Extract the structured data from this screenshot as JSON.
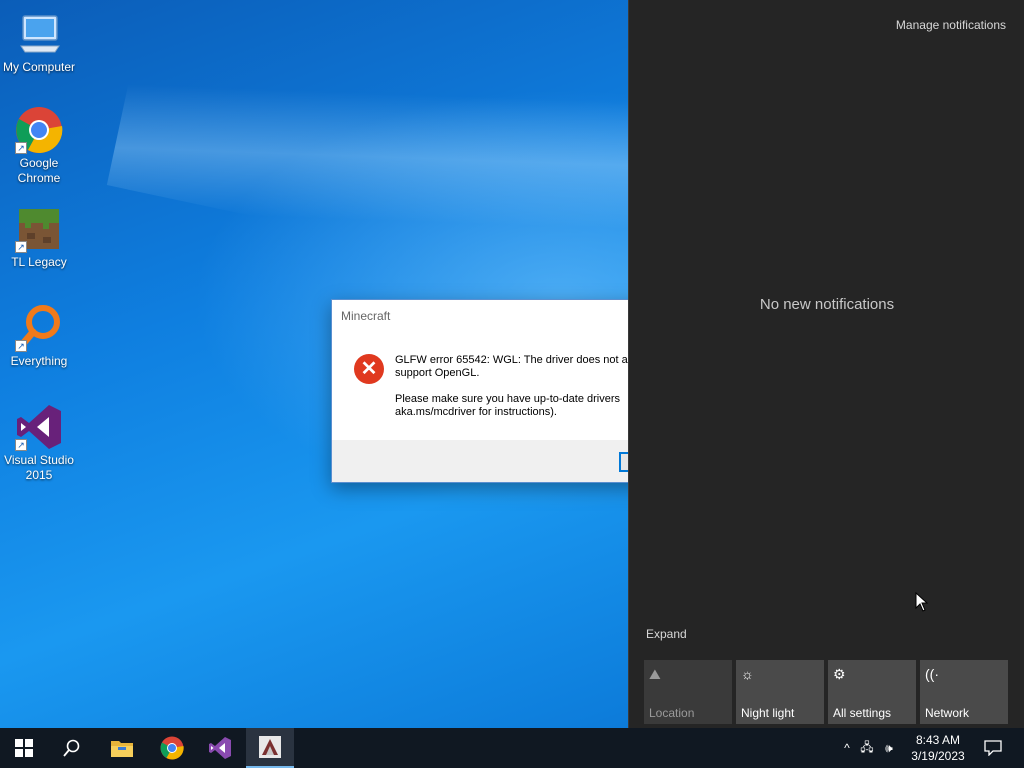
{
  "desktop": {
    "icons": [
      {
        "label": "My Computer",
        "icon": "computer-icon"
      },
      {
        "label": "Google Chrome",
        "icon": "chrome-icon"
      },
      {
        "label": "TL Legacy",
        "icon": "minecraft-block-icon"
      },
      {
        "label": "Everything",
        "icon": "magnifier-icon"
      },
      {
        "label": "Visual Studio 2015",
        "icon": "visual-studio-icon"
      }
    ]
  },
  "dialog": {
    "title": "Minecraft",
    "message": "GLFW error 65542: WGL: The driver does not a\nsupport OpenGL.\n\nPlease make sure you have up-to-date drivers\naka.ms/mcdriver for instructions).",
    "icon": "error-icon",
    "error_glyph": "✕"
  },
  "action_center": {
    "manage_label": "Manage notifications",
    "empty_label": "No new notifications",
    "expand_label": "Expand",
    "tiles": [
      {
        "label": "Location",
        "icon": "location-icon",
        "glyph": "⛰",
        "enabled": false
      },
      {
        "label": "Night light",
        "icon": "sun-icon",
        "glyph": "☼",
        "enabled": true
      },
      {
        "label": "All settings",
        "icon": "gear-icon",
        "glyph": "⚙",
        "enabled": true
      },
      {
        "label": "Network",
        "icon": "network-icon",
        "glyph": "((·",
        "enabled": true
      }
    ]
  },
  "taskbar": {
    "items": [
      {
        "name": "start-button",
        "icon": "windows-icon"
      },
      {
        "name": "search-button",
        "icon": "search-icon"
      },
      {
        "name": "file-explorer-button",
        "icon": "folder-icon"
      },
      {
        "name": "chrome-taskbar-button",
        "icon": "chrome-icon"
      },
      {
        "name": "visual-studio-taskbar-button",
        "icon": "visual-studio-icon"
      },
      {
        "name": "minecraft-launcher-taskbar-button",
        "icon": "launcher-icon"
      }
    ],
    "tray": {
      "chevron": "^",
      "network": "🖧",
      "volume": "🕪"
    },
    "time": "8:43 AM",
    "date": "3/19/2023"
  }
}
